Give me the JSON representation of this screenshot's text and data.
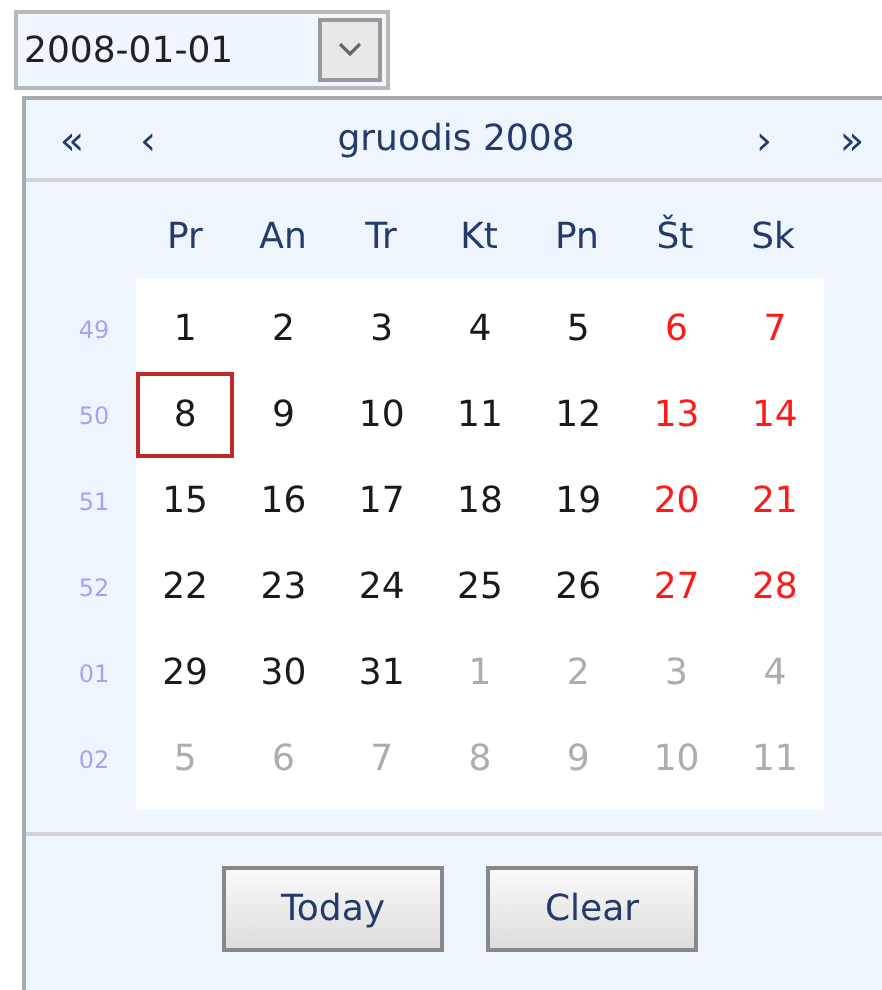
{
  "date_field": {
    "value": "2008-01-01"
  },
  "calendar": {
    "title": "gruodis 2008",
    "nav": {
      "prev_year": "«",
      "prev_month": "‹",
      "next_month": "›",
      "next_year": "»"
    },
    "weekdays": [
      "Pr",
      "An",
      "Tr",
      "Kt",
      "Pn",
      "Št",
      "Sk"
    ],
    "weeks": [
      {
        "number": "49",
        "days": [
          {
            "label": "1",
            "kind": "current",
            "weekend": false,
            "selected": false
          },
          {
            "label": "2",
            "kind": "current",
            "weekend": false,
            "selected": false
          },
          {
            "label": "3",
            "kind": "current",
            "weekend": false,
            "selected": false
          },
          {
            "label": "4",
            "kind": "current",
            "weekend": false,
            "selected": false
          },
          {
            "label": "5",
            "kind": "current",
            "weekend": false,
            "selected": false
          },
          {
            "label": "6",
            "kind": "current",
            "weekend": true,
            "selected": false
          },
          {
            "label": "7",
            "kind": "current",
            "weekend": true,
            "selected": false
          }
        ]
      },
      {
        "number": "50",
        "days": [
          {
            "label": "8",
            "kind": "current",
            "weekend": false,
            "selected": true
          },
          {
            "label": "9",
            "kind": "current",
            "weekend": false,
            "selected": false
          },
          {
            "label": "10",
            "kind": "current",
            "weekend": false,
            "selected": false
          },
          {
            "label": "11",
            "kind": "current",
            "weekend": false,
            "selected": false
          },
          {
            "label": "12",
            "kind": "current",
            "weekend": false,
            "selected": false
          },
          {
            "label": "13",
            "kind": "current",
            "weekend": true,
            "selected": false
          },
          {
            "label": "14",
            "kind": "current",
            "weekend": true,
            "selected": false
          }
        ]
      },
      {
        "number": "51",
        "days": [
          {
            "label": "15",
            "kind": "current",
            "weekend": false,
            "selected": false
          },
          {
            "label": "16",
            "kind": "current",
            "weekend": false,
            "selected": false
          },
          {
            "label": "17",
            "kind": "current",
            "weekend": false,
            "selected": false
          },
          {
            "label": "18",
            "kind": "current",
            "weekend": false,
            "selected": false
          },
          {
            "label": "19",
            "kind": "current",
            "weekend": false,
            "selected": false
          },
          {
            "label": "20",
            "kind": "current",
            "weekend": true,
            "selected": false
          },
          {
            "label": "21",
            "kind": "current",
            "weekend": true,
            "selected": false
          }
        ]
      },
      {
        "number": "52",
        "days": [
          {
            "label": "22",
            "kind": "current",
            "weekend": false,
            "selected": false
          },
          {
            "label": "23",
            "kind": "current",
            "weekend": false,
            "selected": false
          },
          {
            "label": "24",
            "kind": "current",
            "weekend": false,
            "selected": false
          },
          {
            "label": "25",
            "kind": "current",
            "weekend": false,
            "selected": false
          },
          {
            "label": "26",
            "kind": "current",
            "weekend": false,
            "selected": false
          },
          {
            "label": "27",
            "kind": "current",
            "weekend": true,
            "selected": false
          },
          {
            "label": "28",
            "kind": "current",
            "weekend": true,
            "selected": false
          }
        ]
      },
      {
        "number": "01",
        "days": [
          {
            "label": "29",
            "kind": "current",
            "weekend": false,
            "selected": false
          },
          {
            "label": "30",
            "kind": "current",
            "weekend": false,
            "selected": false
          },
          {
            "label": "31",
            "kind": "current",
            "weekend": false,
            "selected": false
          },
          {
            "label": "1",
            "kind": "other",
            "selected": false
          },
          {
            "label": "2",
            "kind": "other",
            "selected": false
          },
          {
            "label": "3",
            "kind": "other",
            "selected": false
          },
          {
            "label": "4",
            "kind": "other",
            "selected": false
          }
        ]
      },
      {
        "number": "02",
        "days": [
          {
            "label": "5",
            "kind": "other",
            "selected": false
          },
          {
            "label": "6",
            "kind": "other",
            "selected": false
          },
          {
            "label": "7",
            "kind": "other",
            "selected": false
          },
          {
            "label": "8",
            "kind": "other",
            "selected": false
          },
          {
            "label": "9",
            "kind": "other",
            "selected": false
          },
          {
            "label": "10",
            "kind": "other",
            "selected": false
          },
          {
            "label": "11",
            "kind": "other",
            "selected": false
          }
        ]
      }
    ],
    "buttons": [
      "Today",
      "Clear"
    ]
  }
}
